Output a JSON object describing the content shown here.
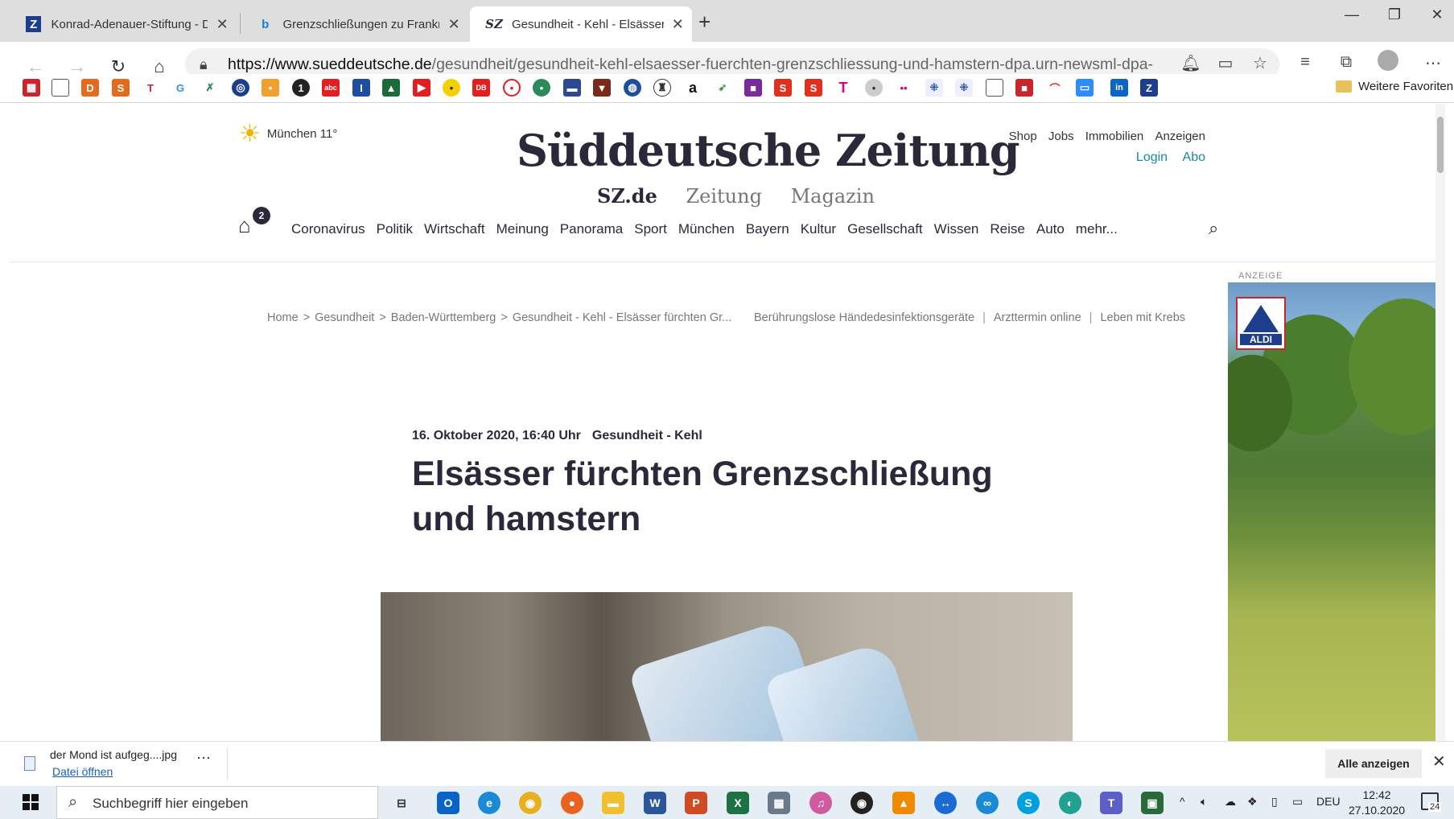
{
  "browser": {
    "tabs": [
      {
        "title": "Konrad-Adenauer-Stiftung - Digi",
        "icon": "kas-icon"
      },
      {
        "title": "Grenzschließungen zu Frankreich",
        "icon": "bing-icon"
      },
      {
        "title": "Gesundheit - Kehl - Elsässer fürch",
        "icon": "sz-icon"
      }
    ],
    "new_tab": "+",
    "url_host": "https://www.sueddeutsche.de",
    "url_path": "/gesundheit/gesundheit-kehl-elsaesser-fuerchten-grenzschliessung-und-hamstern-dpa.urn-newsml-dpa-co...",
    "favorites_more": "Weitere Favoriten"
  },
  "site": {
    "weather": "München  11°",
    "logo": "Süddeutsche Zeitung",
    "tagline": [
      "SZ.de",
      "Zeitung",
      "Magazin"
    ],
    "service_links": [
      "Shop",
      "Jobs",
      "Immobilien",
      "Anzeigen"
    ],
    "account_links": [
      "Login",
      "Abo"
    ],
    "home_badge": "2",
    "nav": [
      "Coronavirus",
      "Politik",
      "Wirtschaft",
      "Meinung",
      "Panorama",
      "Sport",
      "München",
      "Bayern",
      "Kultur",
      "Gesellschaft",
      "Wissen",
      "Reise",
      "Auto",
      "mehr..."
    ],
    "breadcrumbs": [
      "Home",
      "Gesundheit",
      "Baden-Württemberg",
      "Gesundheit - Kehl - Elsässer fürchten Gr..."
    ],
    "quick_links": [
      "Berührungslose Händedesinfektionsgeräte",
      "Arzttermin online",
      "Leben mit Krebs"
    ],
    "ad_label": "ANZEIGE",
    "ad_brand": "ALDI"
  },
  "article": {
    "date": "16. Oktober 2020, 16:40 Uhr",
    "category": "Gesundheit - Kehl",
    "headline": "Elsässer fürchten Grenzschließung und hamstern"
  },
  "download": {
    "file": "der Mond ist aufgeg....jpg",
    "open": "Datei öffnen",
    "show_all": "Alle anzeigen"
  },
  "taskbar": {
    "search_placeholder": "Suchbegriff hier eingeben",
    "lang": "DEU",
    "time": "12:42",
    "date": "27.10.2020",
    "notifications": "24"
  }
}
